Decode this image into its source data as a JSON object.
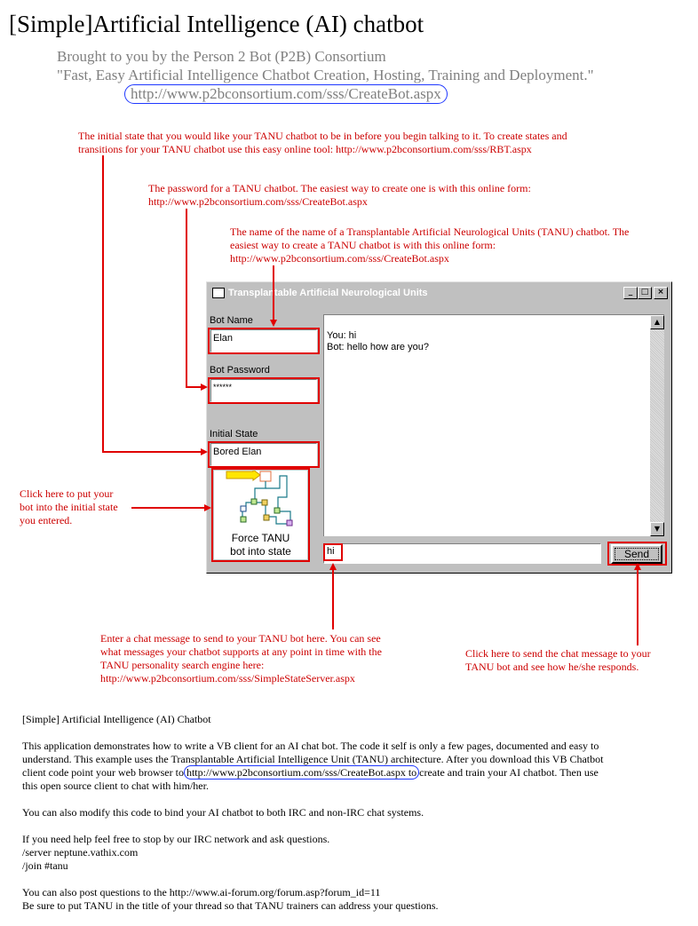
{
  "header": {
    "title": "[Simple]Artificial Intelligence (AI) chatbot",
    "subtitle": "Brought to you by the Person 2 Bot (P2B) Consortium",
    "tagline": "\"Fast, Easy Artificial Intelligence Chatbot Creation, Hosting, Training and Deployment.\"",
    "link": "http://www.p2bconsortium.com/sss/CreateBot.aspx"
  },
  "annotations": {
    "initial_state_1": "The initial state that you would like your TANU chatbot to be in before you begin talking to it. To create states and",
    "initial_state_2": "transitions for your TANU chatbot use this easy online tool: http://www.p2bconsortium.com/sss/RBT.aspx",
    "password_1": "The password for a TANU chatbot. The easiest way to create one is with this online form:",
    "password_2": "http://www.p2bconsortium.com/sss/CreateBot.aspx",
    "name_1": "The name of the name of a Transplantable Artificial Neurological Units (TANU) chatbot. The",
    "name_2": "easiest way to create a TANU chatbot is with this online form:",
    "name_3": "http://www.p2bconsortium.com/sss/CreateBot.aspx",
    "force_1": "Click here to put your",
    "force_2": "bot into the initial state",
    "force_3": "you entered.",
    "message_1": "Enter a chat message to send to your TANU bot here. You can see",
    "message_2": "what messages your chatbot supports at any point in time with the",
    "message_3": "TANU personality search engine here:",
    "message_4": "http://www.p2bconsortium.com/sss/SimpleStateServer.aspx",
    "send_1": "Click here to send the chat message to your",
    "send_2": "TANU bot and see how he/she responds."
  },
  "window": {
    "title": "Transplantable Artificial Neurological Units",
    "bot_name_label": "Bot Name",
    "bot_name_value": "Elan",
    "bot_password_label": "Bot Password",
    "bot_password_value": "******",
    "initial_state_label": "Initial State",
    "initial_state_value": "Bored Elan",
    "force_button_line1": "Force TANU",
    "force_button_line2": "bot into state",
    "chat_line1": "You: hi",
    "chat_line2": "Bot: hello how are you?",
    "message_value": "hi",
    "send_label": "Send",
    "minimize": "_",
    "maximize": "□",
    "close": "×",
    "scroll_up": "▲",
    "scroll_down": "▼"
  },
  "description": {
    "heading": "[Simple] Artificial Intelligence (AI) Chatbot",
    "p1a": "This application demonstrates how to write a VB client for an AI chat bot. The code it self is only a few pages, documented and easy to",
    "p1b": "understand. This example uses the Transplantable Artificial Intelligence Unit (TANU) architecture. After you download this VB Chatbot",
    "p1c_pre": "client code point your web browser to",
    "p1c_link": "http://www.p2bconsortium.com/sss/CreateBot.aspx to",
    "p1c_post": "create and train your AI chatbot. Then use",
    "p1d": "this open source client to chat with him/her.",
    "p2": "You can also modify this code to bind your AI chatbot to both IRC and non-IRC chat systems.",
    "p3a": "If you need help feel free to stop by our IRC network and ask questions.",
    "p3b": "/server neptune.vathix.com",
    "p3c": "/join #tanu",
    "p4a": "You can also post questions to the http://www.ai-forum.org/forum.asp?forum_id=11",
    "p4b": "Be sure to put TANU in the title of your thread so that TANU trainers can address your questions."
  },
  "colors": {
    "annotation_red": "#cc0000",
    "link_outline": "#1f38ff",
    "window_face": "#c0c0c0"
  }
}
